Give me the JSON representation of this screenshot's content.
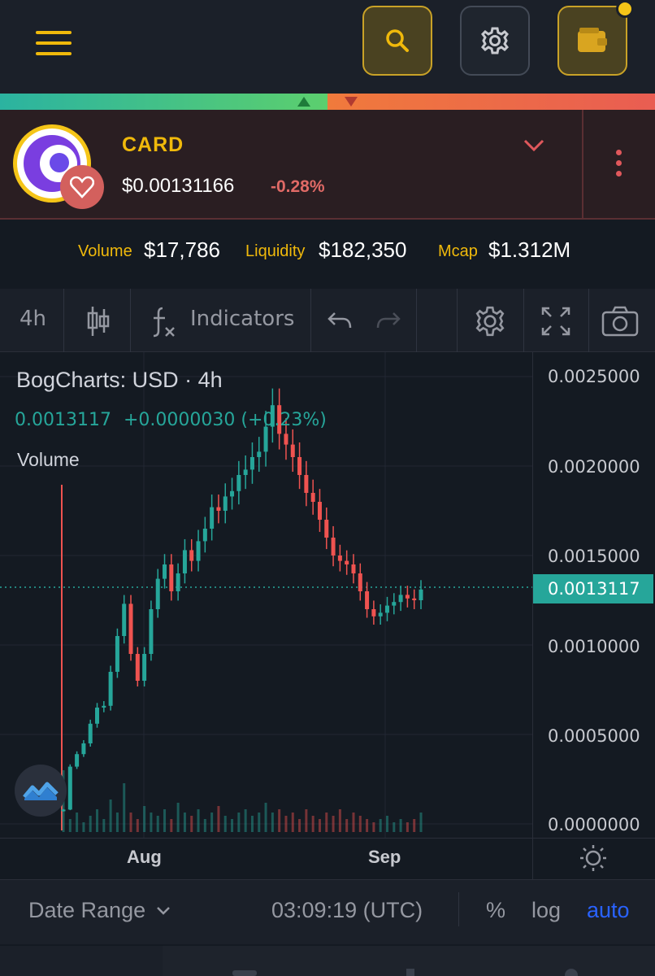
{
  "colors": {
    "accent": "#f0b90b",
    "up": "#26a69a",
    "down": "#ef5350",
    "background": "#141a22"
  },
  "header": {
    "menu_icon": "hamburger-icon",
    "search_icon": "search-icon",
    "settings_icon": "gear-icon",
    "wallet_icon": "wallet-icon"
  },
  "token": {
    "symbol": "CARD",
    "price": "$0.00131166",
    "change": "-0.28%"
  },
  "stats": {
    "volume_label": "Volume",
    "volume_value": "$17,786",
    "liquidity_label": "Liquidity",
    "liquidity_value": "$182,350",
    "mcap_label": "Mcap",
    "mcap_value": "$1.312M"
  },
  "toolbar": {
    "interval": "4h",
    "indicators": "Indicators"
  },
  "legend": {
    "title": "BogCharts: USD · 4h",
    "ohlc": "0.0013117",
    "delta": "+0.0000030 (+0.23%)",
    "volume": "Volume"
  },
  "chart_data": {
    "type": "candlestick",
    "interval": "4h",
    "yticks": [
      "0.0025000",
      "0.0020000",
      "0.0015000",
      "0.0010000",
      "0.0005000",
      "0.0000000"
    ],
    "ylim": [
      0,
      0.0025
    ],
    "xticks": [
      "Aug",
      "Sep"
    ],
    "current_price": "0.0013117",
    "close_series": [
      8e-05,
      0.00032,
      0.00039,
      0.00045,
      0.00056,
      0.00065,
      0.00066,
      0.00085,
      0.00105,
      0.00123,
      0.00095,
      0.0008,
      0.00095,
      0.0012,
      0.00137,
      0.00145,
      0.0013,
      0.0014,
      0.00153,
      0.00147,
      0.00158,
      0.00165,
      0.00177,
      0.00175,
      0.00183,
      0.00186,
      0.00195,
      0.00198,
      0.00205,
      0.00208,
      0.00222,
      0.00234,
      0.00218,
      0.00212,
      0.00205,
      0.00195,
      0.00185,
      0.0018,
      0.0017,
      0.0016,
      0.0015,
      0.00147,
      0.00145,
      0.0014,
      0.0013,
      0.0012,
      0.00116,
      0.00118,
      0.00122,
      0.00124,
      0.00128,
      0.00126,
      0.00125,
      0.00131
    ],
    "volume_series": [
      0.95,
      0.2,
      0.3,
      0.15,
      0.25,
      0.35,
      0.2,
      0.5,
      0.3,
      0.75,
      0.3,
      0.2,
      0.4,
      0.3,
      0.25,
      0.35,
      0.2,
      0.45,
      0.3,
      0.25,
      0.35,
      0.2,
      0.3,
      0.4,
      0.25,
      0.2,
      0.3,
      0.35,
      0.25,
      0.3,
      0.45,
      0.3,
      0.35,
      0.25,
      0.3,
      0.2,
      0.35,
      0.25,
      0.2,
      0.3,
      0.25,
      0.35,
      0.2,
      0.3,
      0.25,
      0.2,
      0.15,
      0.2,
      0.25,
      0.15,
      0.2,
      0.15,
      0.2,
      0.3
    ]
  },
  "bottom": {
    "date_range": "Date Range",
    "time": "03:09:19 (UTC)",
    "percent": "%",
    "log": "log",
    "auto": "auto"
  }
}
